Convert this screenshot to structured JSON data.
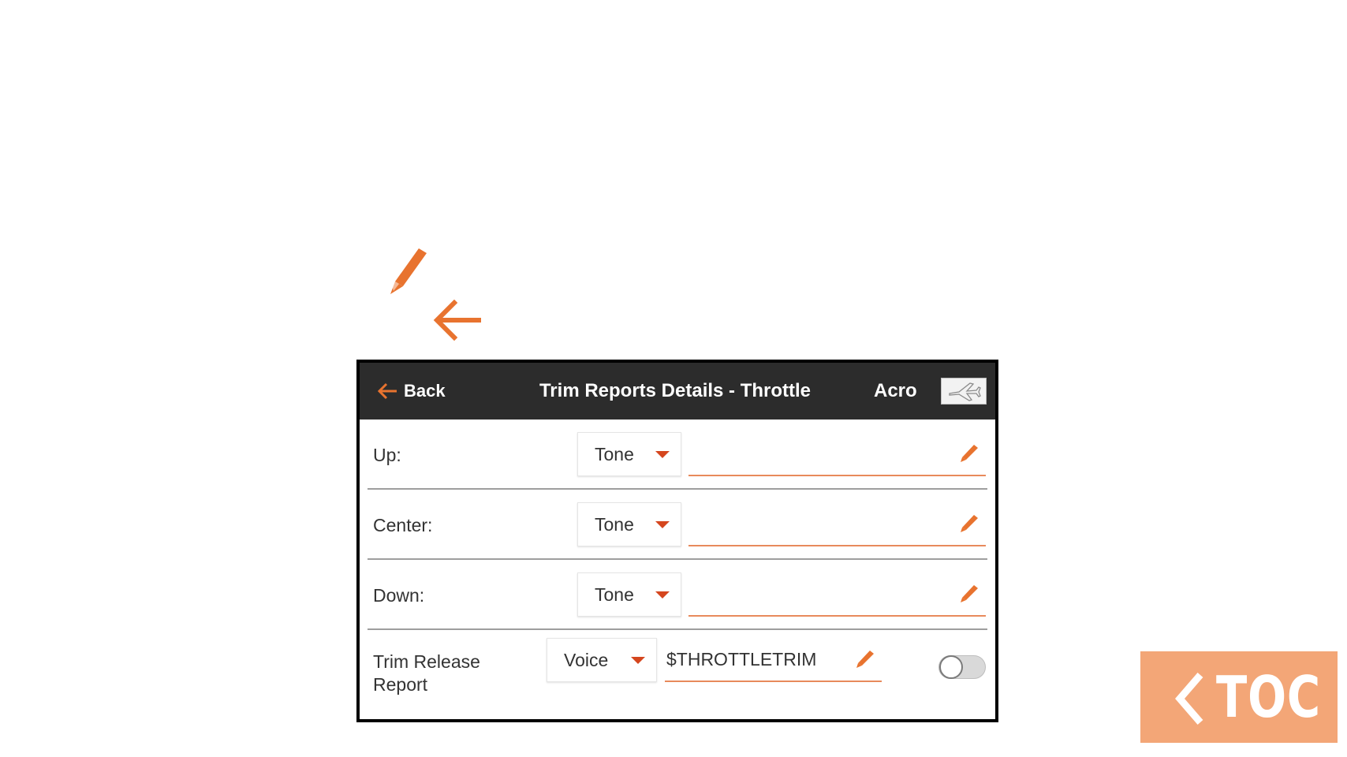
{
  "header": {
    "back_label": "Back",
    "title": "Trim Reports Details - Throttle",
    "mode": "Acro"
  },
  "rows": [
    {
      "label": "Up:",
      "select_value": "Tone",
      "text_value": ""
    },
    {
      "label": "Center:",
      "select_value": "Tone",
      "text_value": ""
    },
    {
      "label": "Down:",
      "select_value": "Tone",
      "text_value": ""
    },
    {
      "label": "Trim Release Report",
      "select_value": "Voice",
      "text_value": "$THROTTLETRIM",
      "toggle_on": false
    }
  ],
  "toc": {
    "label": "TOC"
  },
  "icons": {
    "legend_edit": "pencil-icon",
    "legend_back": "back-arrow-icon",
    "model": "airplane-icon"
  },
  "colors": {
    "accent": "#e8732f",
    "caret": "#d5461e",
    "topbar": "#2c2c2c",
    "toc_bg": "#f3a677"
  }
}
